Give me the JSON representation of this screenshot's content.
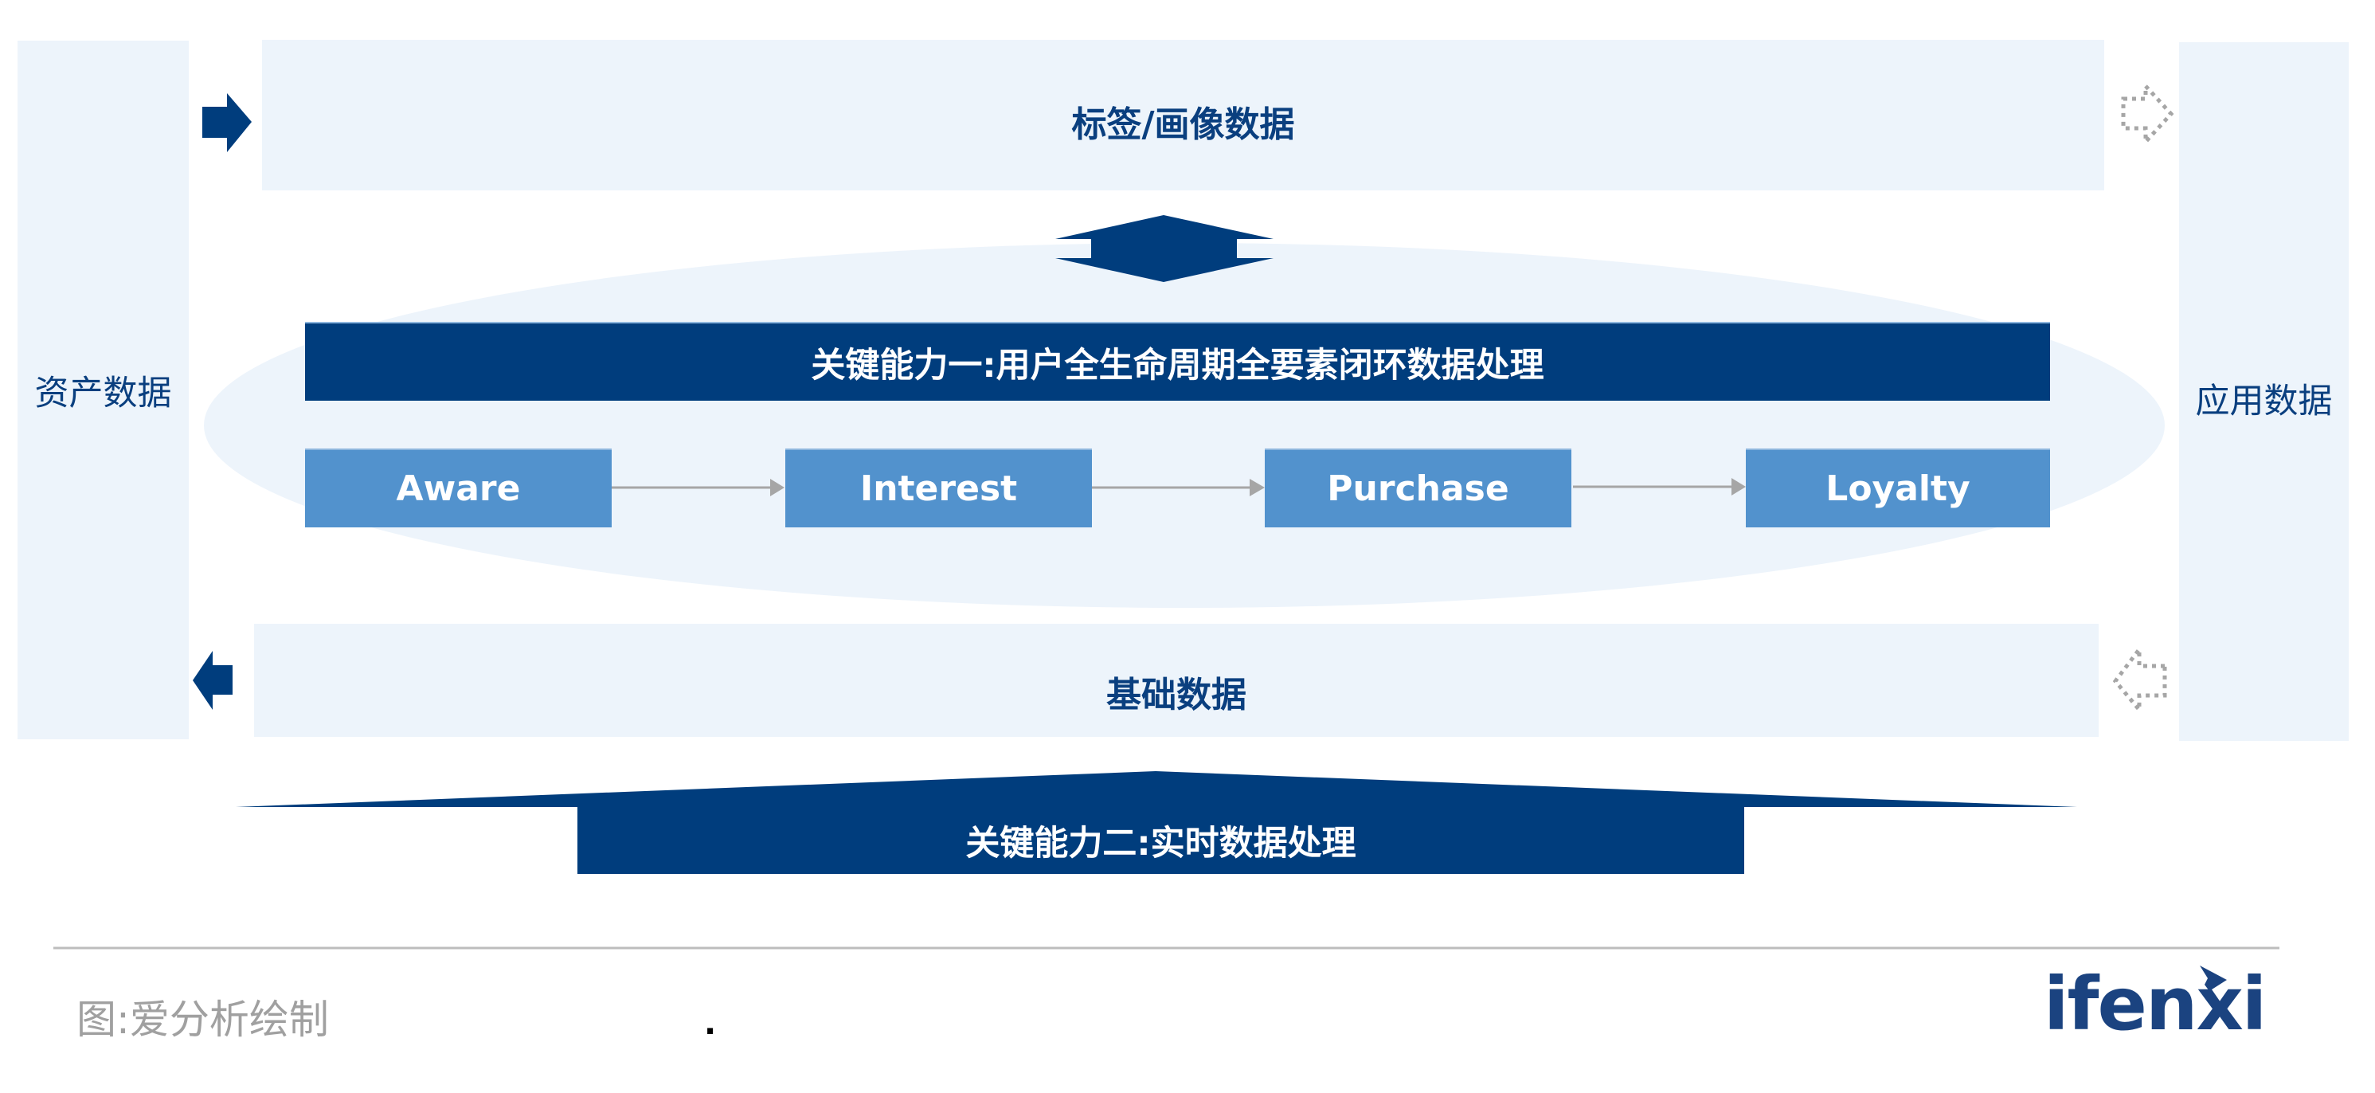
{
  "side_panels": {
    "left": {
      "label": "资产数据"
    },
    "right": {
      "label": "应用数据"
    }
  },
  "top_banner": {
    "label": "标签/画像数据"
  },
  "bottom_banner": {
    "label": "基础数据"
  },
  "capability_one": {
    "label": "关键能力一:用户全生命周期全要素闭环数据处理",
    "stages": [
      {
        "label": "Aware"
      },
      {
        "label": "Interest"
      },
      {
        "label": "Purchase"
      },
      {
        "label": "Loyalty"
      }
    ]
  },
  "capability_two": {
    "label": "关键能力二:实时数据处理"
  },
  "arrows": {
    "top_left": {
      "icon": "arrow-right-solid-icon"
    },
    "top_right": {
      "icon": "arrow-right-dotted-icon"
    },
    "bottom_left": {
      "icon": "arrow-left-solid-icon"
    },
    "bottom_right": {
      "icon": "arrow-left-dotted-icon"
    },
    "center": {
      "icon": "double-arrow-vertical-icon"
    },
    "flow": {
      "icon": "arrow-right-thin-icon"
    }
  },
  "footer": {
    "source_note": "图:爱分析绘制",
    "dot": ".",
    "logo_text": "ifenxi"
  },
  "colors": {
    "primary_dark": "#003D7D",
    "stage_blue": "#5292CD",
    "panel_light": "#EDF4FB",
    "text_blue": "#0A3F7F",
    "gray_arrow": "#A6A6A6",
    "footer_gray": "#A0A0A0",
    "logo_blue": "#1B4380"
  }
}
